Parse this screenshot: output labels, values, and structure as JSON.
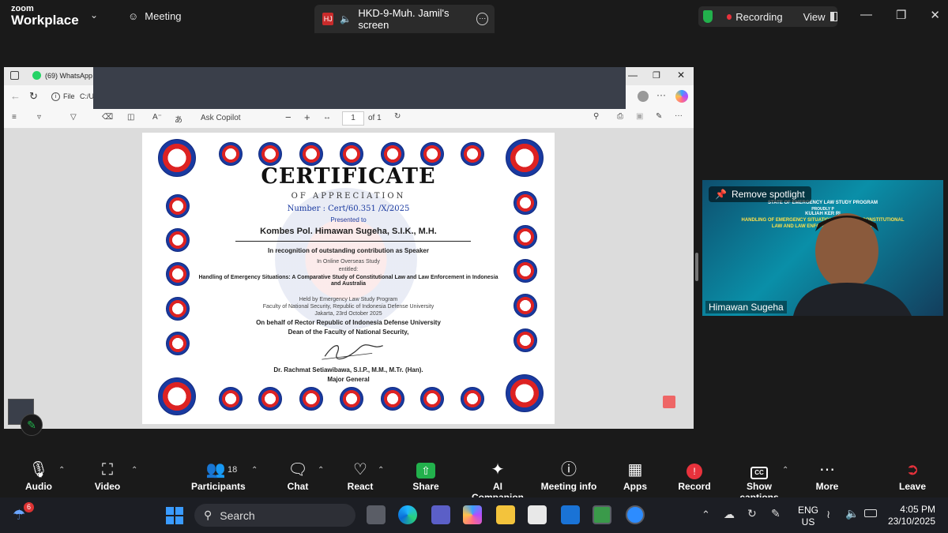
{
  "app": {
    "logo_top": "zoom",
    "logo_bottom": "Workplace",
    "meeting_label": "Meeting",
    "screen_tab_badge": "HJ",
    "screen_tab_label": "HKD-9-Muh. Jamil's screen",
    "recording_label": "Recording",
    "view_label": "View"
  },
  "shared_browser": {
    "tab_title": "(69) WhatsApp",
    "file_label": "File",
    "address": "C:/U",
    "ask_copilot": "Ask Copilot",
    "page_current": "1",
    "page_of": "of 1"
  },
  "certificate": {
    "title": "CERTIFICATE",
    "subtitle": "OF APPRECIATION",
    "number": "Number : Cert/60.351 /X/2025",
    "presented_to": "Presented to",
    "recipient": "Kombes Pol. Himawan Sugeha, S.I.K., M.H.",
    "recognition": "In recognition of outstanding contribution as Speaker",
    "held_in": "In Online Overseas Study",
    "entitled": "entitled:",
    "topic": "Handling of Emergency Situations: A Comparative Study of Constitutional Law and Law Enforcement in Indonesia and Australia",
    "held_by": "Held by Emergency Law Study Program",
    "faculty": "Faculty of National Security, Republic of Indonesia Defense University",
    "date": "Jakarta, 23rd October 2025",
    "behalf": "On behalf of  Rector Republic of Indonesia Defense University",
    "dean": "Dean of the Faculty of National Security,",
    "signatory": "Dr. Rachmat Setiawibawa, S.I.P., M.M., M.Tr. (Han).",
    "rank": "Major General"
  },
  "participant_tile": {
    "spotlight_button": "Remove spotlight",
    "banner_line1": "STATE OF EMERGENCY LAW STUDY PROGRAM",
    "banner_line2": "PROUDLY P",
    "banner_line3": "KULIAH KER                    RI",
    "banner_line4": "HANDLING OF EMERGENCY SITUATIONS          STUDY OF CONSTITUTIONAL",
    "banner_line5": "LAW AND LAW ENFORCEME              ND AUSTRALIA",
    "name": "Himawan Sugeha"
  },
  "toolbar": {
    "audio": "Audio",
    "video": "Video",
    "participants": "Participants",
    "participants_count": "18",
    "chat": "Chat",
    "react": "React",
    "share": "Share",
    "ai_companion": "AI Companion",
    "meeting_info": "Meeting info",
    "apps": "Apps",
    "record": "Record",
    "show_captions": "Show captions",
    "more": "More",
    "leave": "Leave"
  },
  "taskbar": {
    "weather_badge": "6",
    "search_placeholder": "Search",
    "lang_top": "ENG",
    "lang_bottom": "US",
    "time": "4:05 PM",
    "date": "23/10/2025"
  },
  "colors": {
    "zoom_bg": "#1a1a1a",
    "share_green": "#22b14c",
    "record_red": "#e8323c",
    "leave_red": "#e8323c",
    "cert_blue": "#1a3aa0"
  }
}
